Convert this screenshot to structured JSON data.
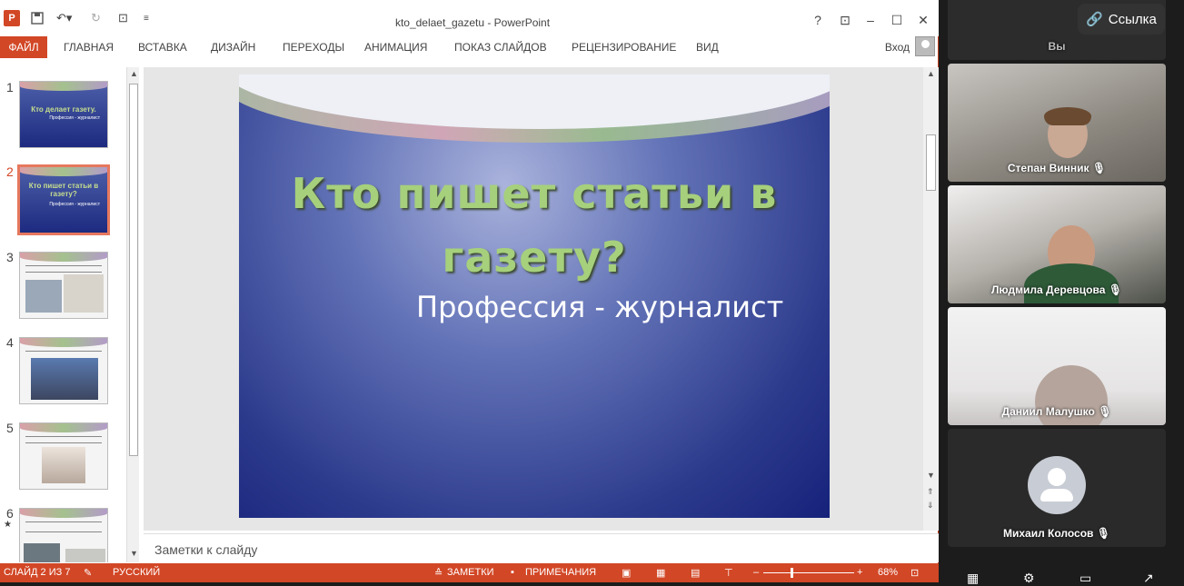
{
  "app": {
    "window_title": "kto_delaet_gazetu - PowerPoint",
    "help_glyph": "?",
    "sign_in": "Вход",
    "file_tab": "ФАЙЛ",
    "tabs": [
      "ГЛАВНАЯ",
      "ВСТАВКА",
      "ДИЗАЙН",
      "ПЕРЕХОДЫ",
      "АНИМАЦИЯ",
      "ПОКАЗ СЛАЙДОВ",
      "РЕЦЕНЗИРОВАНИЕ",
      "ВИД"
    ]
  },
  "thumbnails": [
    {
      "num": "1",
      "title": "Кто делает газету.",
      "sub": "Профессия - журналист"
    },
    {
      "num": "2",
      "title": "Кто пишет статьи в газету?",
      "sub": "Профессия - журналист"
    },
    {
      "num": "3"
    },
    {
      "num": "4"
    },
    {
      "num": "5"
    },
    {
      "num": "6",
      "mark": "★"
    }
  ],
  "slide": {
    "title": "Кто пишет статьи в газету?",
    "subtitle": "Профессия - журналист"
  },
  "notes_placeholder": "Заметки к слайду",
  "status": {
    "slide_info": "СЛАЙД 2 ИЗ 7",
    "language": "РУССКИЙ",
    "notes": "ЗАМЕТКИ",
    "comments": "ПРИМЕЧАНИЯ",
    "zoom": "68%",
    "zoom_level": 0.68
  },
  "meeting": {
    "link_button": "Ссылка",
    "self_label": "Вы",
    "participants": [
      {
        "name": "Степан Винник"
      },
      {
        "name": "Людмила Деревцова"
      },
      {
        "name": "Даниил Малушко"
      },
      {
        "name": "Михаил Колосов"
      }
    ]
  },
  "colors": {
    "accent": "#d24726",
    "slide_title": "#a6d07c"
  }
}
